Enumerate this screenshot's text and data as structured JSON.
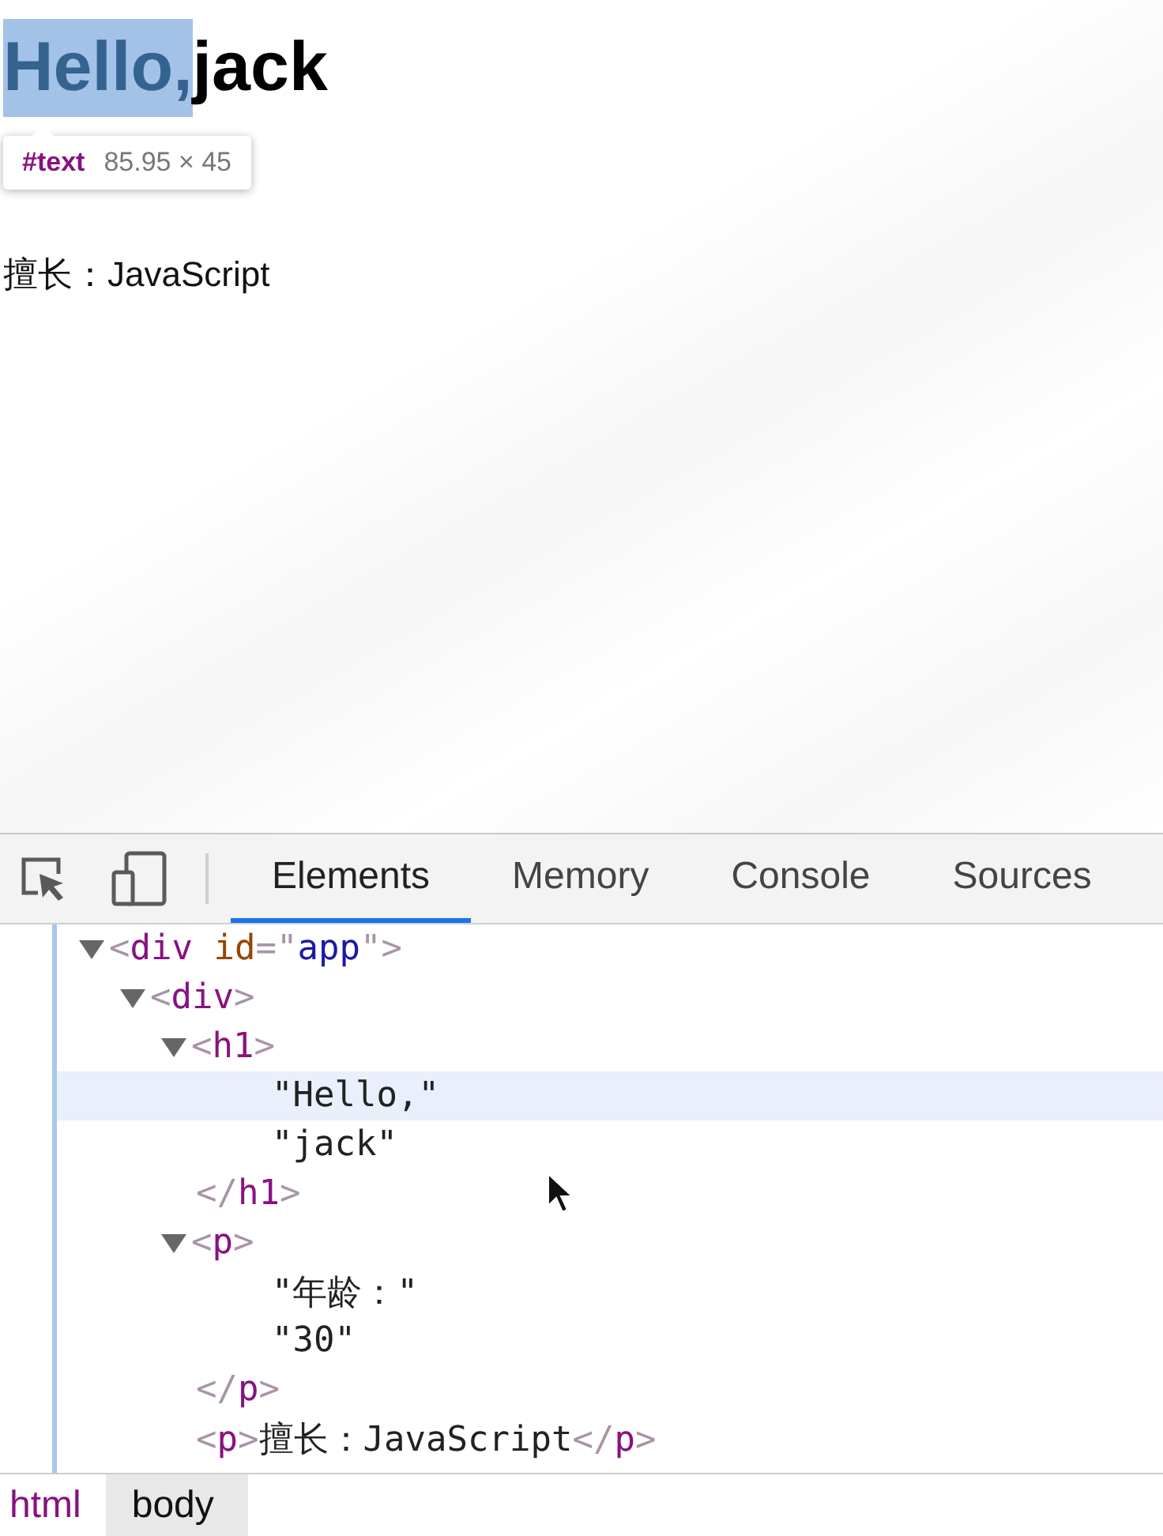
{
  "page": {
    "heading": [
      {
        "text": "Hello,",
        "highlighted": true
      },
      {
        "text": "jack",
        "highlighted": false
      }
    ],
    "paragraphs": [
      "擅长：JavaScript"
    ],
    "tooltip": {
      "node": "#text",
      "size": "85.95 × 45"
    }
  },
  "devtools": {
    "tabs": [
      {
        "label": "Elements",
        "selected": true
      },
      {
        "label": "Memory",
        "selected": false
      },
      {
        "label": "Console",
        "selected": false
      },
      {
        "label": "Sources",
        "selected": false
      }
    ],
    "tree": [
      {
        "kind": "element",
        "expanded": true,
        "selected": false,
        "open": [
          {
            "kind": "bracket",
            "text": "<"
          },
          {
            "kind": "tag",
            "text": "div"
          },
          {
            "kind": "attr",
            "text": " id"
          },
          {
            "kind": "bracket",
            "text": "=\""
          },
          {
            "kind": "value",
            "text": "app"
          },
          {
            "kind": "bracket",
            "text": "\">"
          }
        ],
        "children": [
          {
            "kind": "element",
            "expanded": true,
            "selected": false,
            "open": [
              {
                "kind": "bracket",
                "text": "<"
              },
              {
                "kind": "tag",
                "text": "div"
              },
              {
                "kind": "bracket",
                "text": ">"
              }
            ],
            "children": [
              {
                "kind": "element",
                "expanded": true,
                "selected": false,
                "open": [
                  {
                    "kind": "bracket",
                    "text": "<"
                  },
                  {
                    "kind": "tag",
                    "text": "h1"
                  },
                  {
                    "kind": "bracket",
                    "text": ">"
                  }
                ],
                "close": [
                  {
                    "kind": "bracket",
                    "text": "</"
                  },
                  {
                    "kind": "tag",
                    "text": "h1"
                  },
                  {
                    "kind": "bracket",
                    "text": ">"
                  }
                ],
                "children": [
                  {
                    "kind": "text",
                    "selected": true,
                    "text": "\"Hello,\""
                  },
                  {
                    "kind": "text",
                    "selected": false,
                    "text": "\"jack\""
                  }
                ]
              },
              {
                "kind": "element",
                "expanded": true,
                "selected": false,
                "open": [
                  {
                    "kind": "bracket",
                    "text": "<"
                  },
                  {
                    "kind": "tag",
                    "text": "p"
                  },
                  {
                    "kind": "bracket",
                    "text": ">"
                  }
                ],
                "close": [
                  {
                    "kind": "bracket",
                    "text": "</"
                  },
                  {
                    "kind": "tag",
                    "text": "p"
                  },
                  {
                    "kind": "bracket",
                    "text": ">"
                  }
                ],
                "children": [
                  {
                    "kind": "text",
                    "selected": false,
                    "text": "\"年龄：\""
                  },
                  {
                    "kind": "text",
                    "selected": false,
                    "text": "\"30\""
                  }
                ]
              },
              {
                "kind": "inline",
                "selected": false,
                "open": [
                  {
                    "kind": "bracket",
                    "text": "<"
                  },
                  {
                    "kind": "tag",
                    "text": "p"
                  },
                  {
                    "kind": "bracket",
                    "text": ">"
                  },
                  {
                    "kind": "plain",
                    "text": "擅长：JavaScript"
                  },
                  {
                    "kind": "bracket",
                    "text": "</"
                  },
                  {
                    "kind": "tag",
                    "text": "p"
                  },
                  {
                    "kind": "bracket",
                    "text": ">"
                  }
                ]
              }
            ]
          }
        ]
      }
    ],
    "breadcrumbs": [
      {
        "label": "html",
        "selected": false
      },
      {
        "label": "body",
        "selected": true
      }
    ]
  }
}
